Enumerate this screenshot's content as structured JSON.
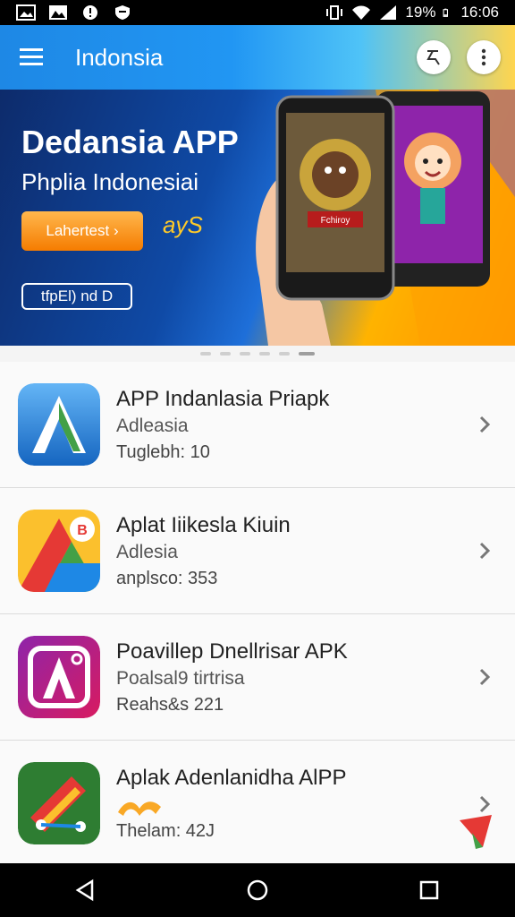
{
  "status_bar": {
    "battery": "19%",
    "time": "16:06"
  },
  "app_bar": {
    "title": "Indonsia"
  },
  "banner": {
    "title": "Dedansia APP",
    "subtitle": "Phplia Indonesiai",
    "cta_label": "Lahertest",
    "tag": "ayS",
    "outline_label": "tfpEl) nd D",
    "phone_label": "Fchiroy"
  },
  "apps": [
    {
      "name": "APP Indanlasia Priapk",
      "sub": "Adleasia",
      "meta": "Tuglebh: 10"
    },
    {
      "name": "Aplat Iiikesla Kiuin",
      "sub": "Adlesia",
      "meta": "anplsco: 353"
    },
    {
      "name": "Poavillep Dnellrisar APK",
      "sub": "Poalsal9 tirtrisa",
      "meta": "Reahs&s 221"
    },
    {
      "name": "Aplak Adenlanidha AlPP",
      "sub": "",
      "meta": "Thelam: 42J"
    }
  ]
}
